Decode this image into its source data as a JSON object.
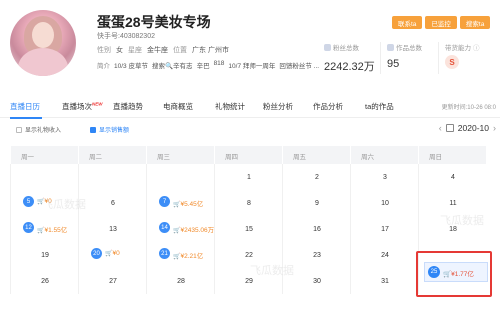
{
  "profile": {
    "name": "蛋蛋28号美妆专场",
    "kuaishou_id": "快手号:403082302",
    "gender_label": "性别",
    "gender": "女",
    "zodiac_label": "星座",
    "zodiac": "金牛座",
    "location_label": "位置",
    "location": "广东 广州市",
    "intro_label": "简介",
    "intro_items": [
      "10/3 皮草节",
      "搜索🔍辛有志",
      "辛巴",
      "818",
      "10/7 拜师一周年",
      "回馈粉丝节 ..."
    ]
  },
  "stats": [
    {
      "label": "粉丝总数",
      "value": "2242.32万"
    },
    {
      "label": "作品总数",
      "value": "95"
    },
    {
      "label": "带货能力",
      "value": "S"
    }
  ],
  "buttons": [
    "联系ta",
    "已监控",
    "搜索ta"
  ],
  "tabs": [
    {
      "label": "直播日历",
      "active": true
    },
    {
      "label": "直播场次",
      "tag": "NEW",
      "active": false
    },
    {
      "label": "直播趋势",
      "active": false
    },
    {
      "label": "电商概览",
      "active": false
    },
    {
      "label": "礼物统计",
      "active": false
    },
    {
      "label": "粉丝分析",
      "active": false
    },
    {
      "label": "作品分析",
      "active": false
    },
    {
      "label": "ta的作品",
      "active": false
    }
  ],
  "updated": "更新时间:10-26 08:0",
  "filters": {
    "gift_income": "显示礼物收入",
    "sales": "显示销售额"
  },
  "month": "2020-10",
  "weekdays": [
    "周一",
    "周二",
    "周三",
    "周四",
    "周五",
    "周六",
    "周日"
  ],
  "calendar": [
    [
      {
        "day": ""
      },
      {
        "day": ""
      },
      {
        "day": ""
      },
      {
        "day": "1"
      },
      {
        "day": "2"
      },
      {
        "day": "3"
      },
      {
        "day": "4"
      }
    ],
    [
      {
        "day": "5",
        "amount": "¥0"
      },
      {
        "day": "6"
      },
      {
        "day": "7",
        "amount": "¥5.45亿"
      },
      {
        "day": "8"
      },
      {
        "day": "9"
      },
      {
        "day": "10"
      },
      {
        "day": "11"
      }
    ],
    [
      {
        "day": "12",
        "amount": "¥1.55亿"
      },
      {
        "day": "13"
      },
      {
        "day": "14",
        "amount": "¥2435.06万"
      },
      {
        "day": "15"
      },
      {
        "day": "16"
      },
      {
        "day": "17"
      },
      {
        "day": "18"
      }
    ],
    [
      {
        "day": "19"
      },
      {
        "day": "20",
        "amount": "¥0"
      },
      {
        "day": "21",
        "amount": "¥2.21亿"
      },
      {
        "day": "22"
      },
      {
        "day": "23"
      },
      {
        "day": "24"
      },
      {
        "day": "25",
        "amount": "¥1.77亿",
        "highlight": true
      }
    ],
    [
      {
        "day": "26"
      },
      {
        "day": "27"
      },
      {
        "day": "28"
      },
      {
        "day": "29"
      },
      {
        "day": "30"
      },
      {
        "day": "31"
      },
      {
        "day": ""
      }
    ]
  ],
  "watermark": "飞瓜数据",
  "colors": {
    "accent": "#2f86f6",
    "button": "#f7a13b",
    "amount": "#f08a2b",
    "highlight": "#e53935"
  }
}
